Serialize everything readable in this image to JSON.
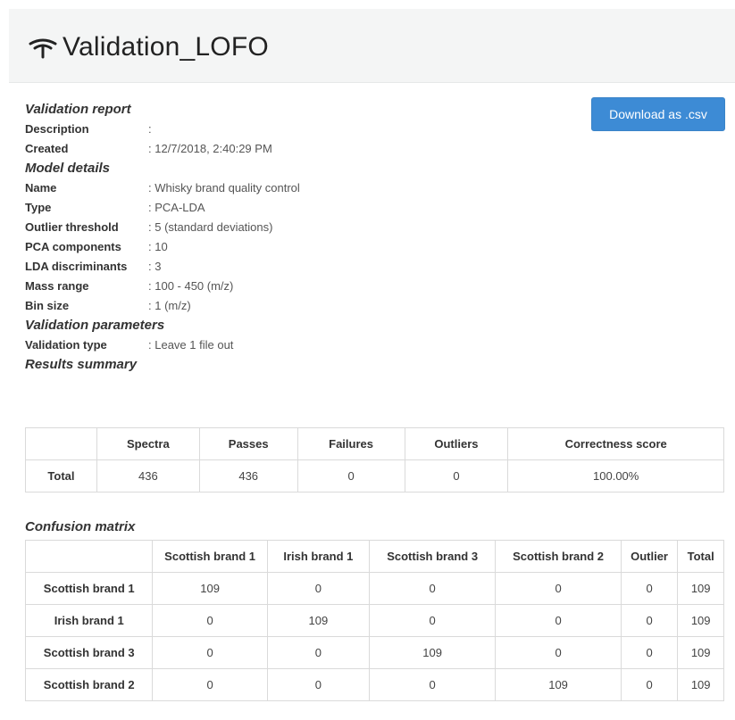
{
  "header": {
    "title": "Validation_LOFO"
  },
  "download_button": "Download as .csv",
  "sections": {
    "report": "Validation report",
    "model": "Model details",
    "params": "Validation parameters",
    "results": "Results summary",
    "confusion": "Confusion matrix"
  },
  "report": [
    {
      "k": "Description",
      "v": ""
    },
    {
      "k": "Created",
      "v": "12/7/2018, 2:40:29 PM"
    }
  ],
  "model": [
    {
      "k": "Name",
      "v": "Whisky brand quality control"
    },
    {
      "k": "Type",
      "v": "PCA-LDA"
    },
    {
      "k": "Outlier threshold",
      "v": "5 (standard deviations)"
    },
    {
      "k": "PCA components",
      "v": "10"
    },
    {
      "k": "LDA discriminants",
      "v": "3"
    },
    {
      "k": "Mass range",
      "v": "100 - 450 (m/z)"
    },
    {
      "k": "Bin size",
      "v": "1 (m/z)"
    }
  ],
  "params": [
    {
      "k": "Validation type",
      "v": "Leave 1 file out"
    }
  ],
  "results_table": {
    "headers": [
      "",
      "Spectra",
      "Passes",
      "Failures",
      "Outliers",
      "Correctness score"
    ],
    "rows": [
      [
        "Total",
        "436",
        "436",
        "0",
        "0",
        "100.00%"
      ]
    ]
  },
  "confusion_table": {
    "headers": [
      "",
      "Scottish brand 1",
      "Irish brand 1",
      "Scottish brand 3",
      "Scottish brand 2",
      "Outlier",
      "Total"
    ],
    "rows": [
      [
        "Scottish brand 1",
        "109",
        "0",
        "0",
        "0",
        "0",
        "109"
      ],
      [
        "Irish brand 1",
        "0",
        "109",
        "0",
        "0",
        "0",
        "109"
      ],
      [
        "Scottish brand 3",
        "0",
        "0",
        "109",
        "0",
        "0",
        "109"
      ],
      [
        "Scottish brand 2",
        "0",
        "0",
        "0",
        "109",
        "0",
        "109"
      ]
    ]
  }
}
